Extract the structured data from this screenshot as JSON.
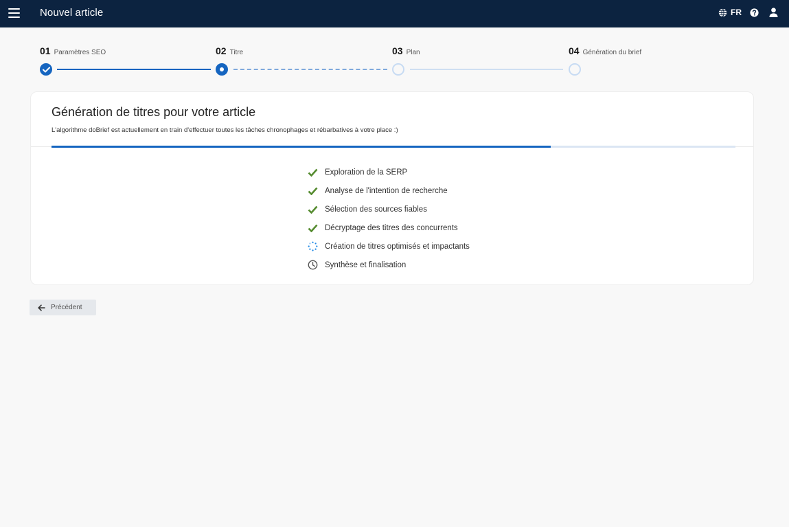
{
  "header": {
    "title": "Nouvel article",
    "language": "FR",
    "icons": [
      "menu-icon",
      "globe-icon",
      "help-icon",
      "user-icon"
    ]
  },
  "stepper": {
    "steps": [
      {
        "number": "01",
        "label": "Paramètres SEO",
        "status": "done"
      },
      {
        "number": "02",
        "label": "Titre",
        "status": "current"
      },
      {
        "number": "03",
        "label": "Plan",
        "status": "todo"
      },
      {
        "number": "04",
        "label": "Génération du brief",
        "status": "todo"
      }
    ]
  },
  "card": {
    "title": "Génération de titres pour votre article",
    "subtitle": "L'algorithme doBrief est actuellement en train d'effectuer toutes les tâches chronophages et rébarbatives à votre place :)",
    "progress_percent": 73
  },
  "tasks": [
    {
      "label": "Exploration de la SERP",
      "status": "done"
    },
    {
      "label": "Analyse de l'intention de recherche",
      "status": "done"
    },
    {
      "label": "Sélection des sources fiables",
      "status": "done"
    },
    {
      "label": "Décryptage des titres des concurrents",
      "status": "done"
    },
    {
      "label": "Création de titres optimisés et impactants",
      "status": "in-progress"
    },
    {
      "label": "Synthèse et finalisation",
      "status": "pending"
    }
  ],
  "footer": {
    "prev_label": "Précédent"
  },
  "colors": {
    "header_bg": "#0c2340",
    "accent": "#1565c0",
    "success": "#558b2f",
    "background": "#f8f8f8"
  }
}
